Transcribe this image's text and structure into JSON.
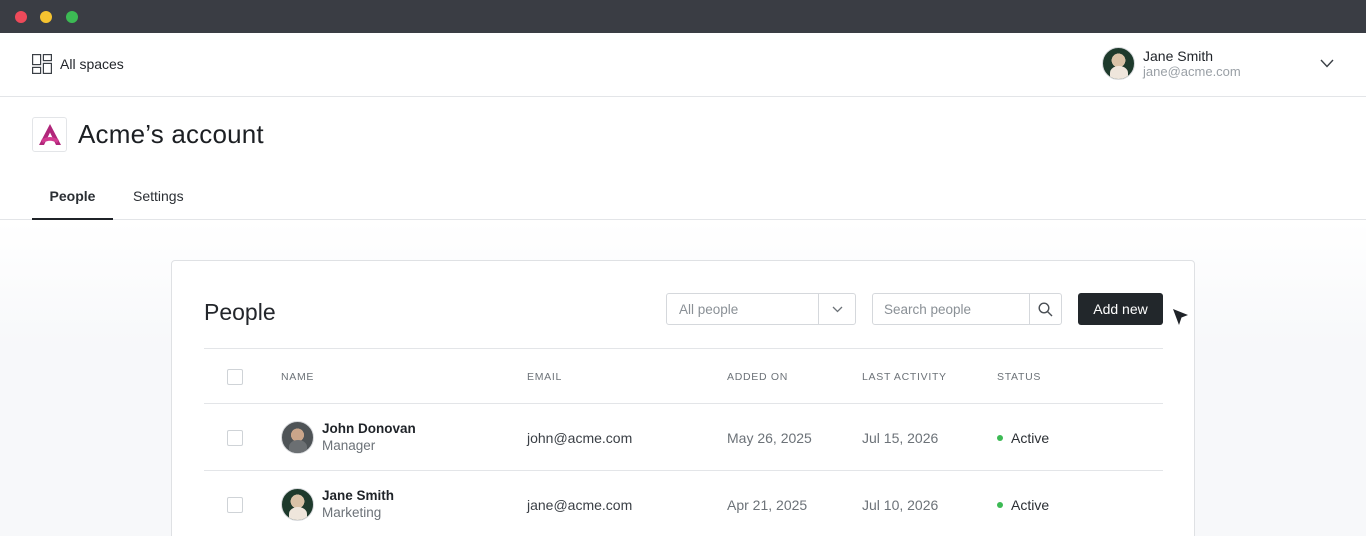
{
  "window": {
    "controls": [
      "close",
      "minimize",
      "maximize"
    ]
  },
  "topbar": {
    "spaces_label": "All spaces",
    "spaces_icon": "grid-icon",
    "user": {
      "name": "Jane Smith",
      "email": "jane@acme.com"
    }
  },
  "account": {
    "title": "Acme’s account",
    "logo_color": "#b0267a"
  },
  "tabs": [
    {
      "label": "People",
      "active": true
    },
    {
      "label": "Settings",
      "active": false
    }
  ],
  "people_panel": {
    "title": "People",
    "filter": {
      "selected": "All people"
    },
    "search": {
      "placeholder": "Search people"
    },
    "add_label": "Add new",
    "columns": [
      "NAME",
      "EMAIL",
      "ADDED ON",
      "LAST ACTIVITY",
      "STATUS"
    ],
    "rows": [
      {
        "name": "John Donovan",
        "role": "Manager",
        "email": "john@acme.com",
        "added_on": "May 26, 2025",
        "last_activity": "Jul 15, 2026",
        "status": "Active"
      },
      {
        "name": "Jane Smith",
        "role": "Marketing",
        "email": "jane@acme.com",
        "added_on": "Apr 21, 2025",
        "last_activity": "Jul 10, 2026",
        "status": "Active"
      }
    ]
  },
  "colors": {
    "titlebar": "#3a3d44",
    "primary_button": "#22272b",
    "status_active": "#3cba54"
  }
}
